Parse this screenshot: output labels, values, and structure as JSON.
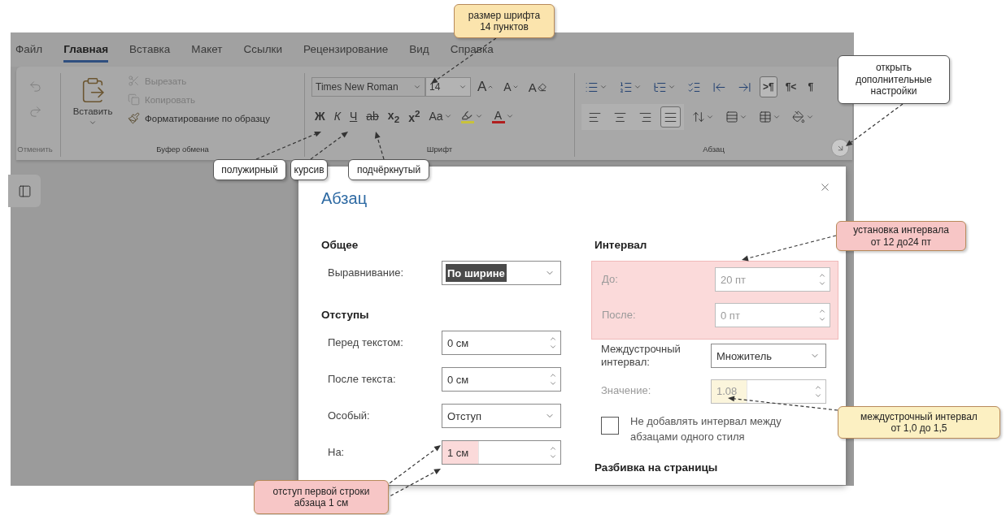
{
  "menu_tabs": [
    {
      "label": "Файл",
      "selected": false
    },
    {
      "label": "Главная",
      "selected": true
    },
    {
      "label": "Вставка",
      "selected": false
    },
    {
      "label": "Макет",
      "selected": false
    },
    {
      "label": "Ссылки",
      "selected": false
    },
    {
      "label": "Рецензирование",
      "selected": false
    },
    {
      "label": "Вид",
      "selected": false
    },
    {
      "label": "Справка",
      "selected": false
    }
  ],
  "ribbon": {
    "undo_group": {
      "label": "Отменить",
      "disabled": true
    },
    "clipboard_group": {
      "label": "Буфер обмена",
      "paste_label": "Вставить",
      "items": [
        {
          "label": "Вырезать",
          "kind": "cut",
          "disabled": true
        },
        {
          "label": "Копировать",
          "kind": "copy",
          "disabled": true
        },
        {
          "label": "Форматирование по образцу",
          "kind": "format-painter",
          "disabled": false
        }
      ]
    },
    "font_group": {
      "label": "Шрифт",
      "font_name": "Times New Roman",
      "font_size": "14",
      "size_buttons": [
        {
          "label": "A",
          "kind": "grow"
        },
        {
          "label": "A",
          "kind": "shrink"
        },
        {
          "label": "A",
          "kind": "clear"
        }
      ],
      "format_buttons": [
        {
          "label": "Ж",
          "kind": "bold"
        },
        {
          "label": "К",
          "kind": "italic"
        },
        {
          "label": "Ч",
          "kind": "underline"
        },
        {
          "label": "ab",
          "kind": "strike"
        },
        {
          "label": "x$_{2}$",
          "kind": "script"
        },
        {
          "label": "x$^{2}$",
          "kind": "script"
        },
        {
          "label": "Aa",
          "kind": "case"
        },
        {
          "kind": "highlight"
        },
        {
          "label": "A",
          "kind": "font-color"
        }
      ]
    },
    "paragraph_group": {
      "label": "Абзац",
      "list_buttons": [
        {
          "kind": "bullets"
        },
        {
          "kind": "numbering"
        },
        {
          "kind": "multilevel"
        },
        {
          "kind": "checklist"
        },
        {
          "kind": "outdent"
        },
        {
          "kind": "indent"
        }
      ],
      "mark_buttons": [
        {
          "label": ">¶",
          "selected": true
        },
        {
          "label": "¶<",
          "selected": false
        },
        {
          "label": "¶",
          "selected": false
        }
      ],
      "align_buttons": [
        {
          "kind": "left",
          "selected": false
        },
        {
          "kind": "center",
          "selected": false
        },
        {
          "kind": "right",
          "selected": false
        },
        {
          "kind": "justify",
          "selected": true
        }
      ],
      "more_buttons": [
        {
          "kind": "line-spacing"
        },
        {
          "kind": "paragraph-spacing"
        },
        {
          "kind": "borders"
        },
        {
          "kind": "shading"
        }
      ]
    }
  },
  "dialog": {
    "title": "Абзац",
    "general": {
      "heading": "Общее",
      "label": "Выравнивание:",
      "value": "По ширине",
      "text_selected": true
    },
    "indents": {
      "heading": "Отступы",
      "rows": [
        {
          "label": "Перед текстом:",
          "value": "0 см",
          "kind": "spin",
          "highlighted": false
        },
        {
          "label": "После текста:",
          "value": "0 см",
          "kind": "spin",
          "highlighted": false
        },
        {
          "label": "Особый:",
          "value": "Отступ",
          "kind": "select",
          "highlighted": false
        },
        {
          "label": "На:",
          "value": "1 см",
          "kind": "spin",
          "highlighted": true,
          "color": "#fbdada"
        }
      ]
    },
    "spacing": {
      "heading": "Интервал",
      "marked_area": {
        "highlighted": true,
        "color": "#fbdada",
        "rows": [
          {
            "label": "До:",
            "value": "20 пт",
            "kind": "spin",
            "disabled": true,
            "highlighted": false
          },
          {
            "label": "После:",
            "value": "0 пт",
            "kind": "spin",
            "disabled": true,
            "highlighted": false
          }
        ]
      },
      "rows": [
        {
          "label": "Междустрочный интервал:",
          "value": "Множитель",
          "kind": "select",
          "disabled": false,
          "highlighted": false
        },
        {
          "label": "Значение:",
          "value": "1.08",
          "kind": "spin",
          "disabled": true,
          "highlighted": true,
          "color": "#fbf5dc"
        }
      ],
      "checkbox": {
        "label": "Не добавлять интервал между абзацами одного стиля",
        "checked": false
      }
    },
    "pagination": {
      "heading": "Разбивка на страницы"
    }
  },
  "callouts": [
    {
      "text": "размер шрифта\n14 пунктов",
      "color": "#fbe4ad"
    },
    {
      "text": "открыть\nдополнительные\nнастройки",
      "color": "#ffffff"
    },
    {
      "text": "полужирный",
      "color": "#ffffff"
    },
    {
      "text": "курсив",
      "color": "#ffffff"
    },
    {
      "text": "подчёркнутый",
      "color": "#ffffff"
    },
    {
      "text": "установка интервала\nот 12 до24 пт",
      "color": "#f7c6c6"
    },
    {
      "text": "междустрочный интервал\nот 1,0 до 1,5",
      "color": "#fcf0c2"
    },
    {
      "text": "отступ первой строки\nабзаца 1 см",
      "color": "#f7c6c6"
    }
  ]
}
